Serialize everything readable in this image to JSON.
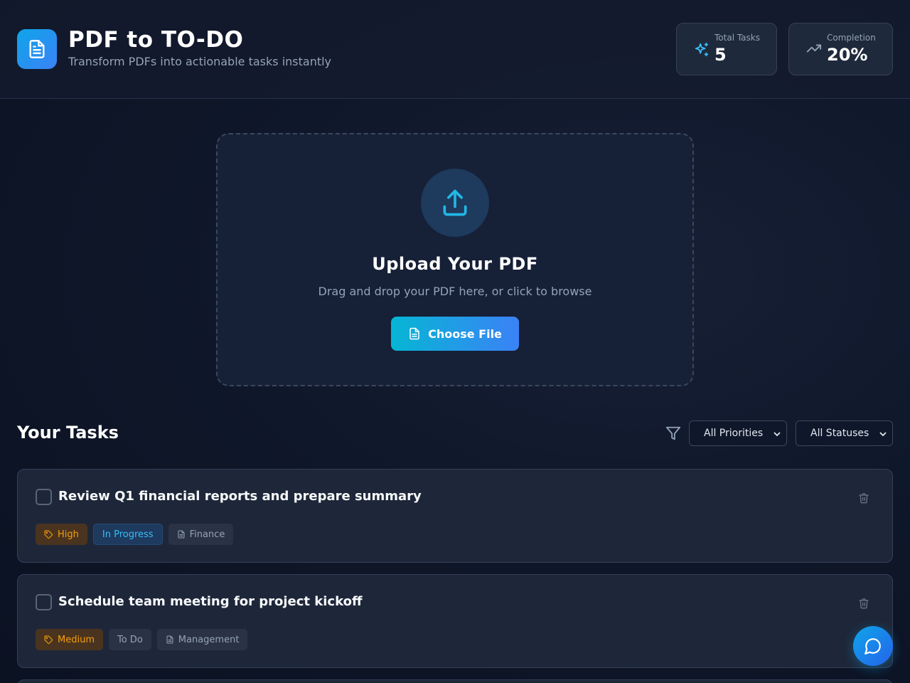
{
  "header": {
    "title": "PDF to TO-DO",
    "subtitle": "Transform PDFs into actionable tasks instantly"
  },
  "stats": {
    "total_tasks": {
      "label": "Total Tasks",
      "value": "5",
      "icon": "sparkles-icon"
    },
    "completion": {
      "label": "Completion",
      "value": "20%",
      "icon": "trending-up-icon"
    }
  },
  "upload": {
    "title": "Upload Your PDF",
    "description": "Drag and drop your PDF here, or click to browse",
    "button_label": "Choose File"
  },
  "tasks_section": {
    "title": "Your Tasks",
    "priority_filter": "All Priorities",
    "status_filter": "All Statuses"
  },
  "tasks": [
    {
      "title": "Review Q1 financial reports and prepare summary",
      "priority": "High",
      "status": "In Progress",
      "category": "Finance",
      "completed": false
    },
    {
      "title": "Schedule team meeting for project kickoff",
      "priority": "Medium",
      "status": "To Do",
      "category": "Management",
      "completed": false
    }
  ],
  "colors": {
    "accent": "#0ea5e9",
    "accent_secondary": "#3b82f6",
    "background": "#0f172a",
    "priority_tag": "#f59e0b",
    "status_in_progress": "#38bdf8"
  }
}
